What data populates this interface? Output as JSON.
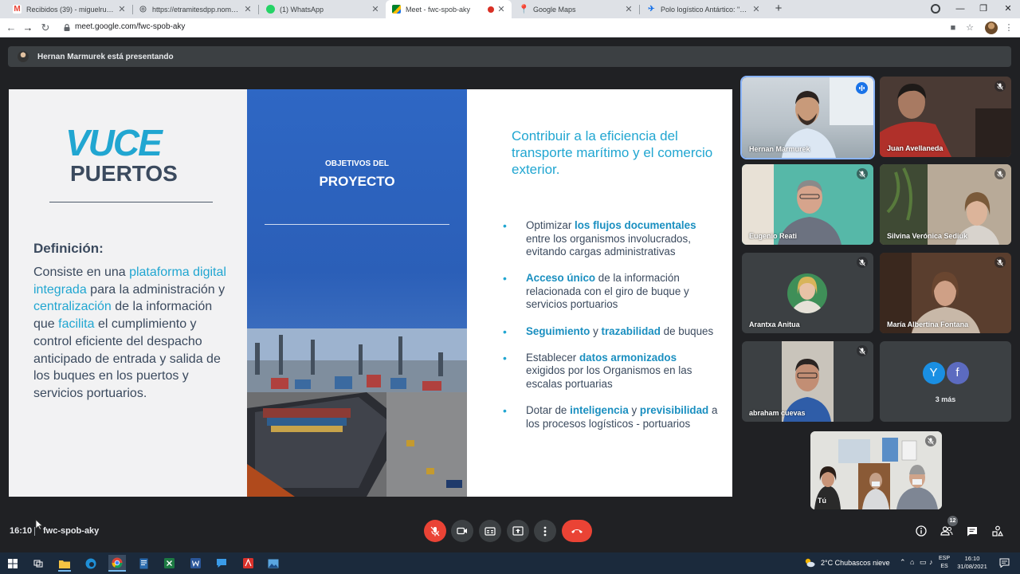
{
  "browser": {
    "tabs": [
      {
        "title": "Recibidos (39) - miguelrushuaia@",
        "icon": "gmail-icon",
        "color": "#ea4335",
        "active": false
      },
      {
        "title": "https://etramitesdpp.nomadesoft",
        "icon": "globe-icon",
        "color": "#5f6368",
        "active": false
      },
      {
        "title": "(1) WhatsApp",
        "icon": "whatsapp-icon",
        "color": "#25d366",
        "active": false
      },
      {
        "title": "Meet - fwc-spob-aky",
        "icon": "meet-icon",
        "color": "#00832d",
        "active": true
      },
      {
        "title": "Google Maps",
        "icon": "maps-icon",
        "color": "#34a853",
        "active": false
      },
      {
        "title": "Polo logístico Antártico: \"Debem",
        "icon": "news-icon",
        "color": "#1a73e8",
        "active": false
      }
    ],
    "new_tab": "+",
    "url": "meet.google.com/fwc-spob-aky"
  },
  "meet": {
    "presenting_text": "Hernan Marmurek está presentando",
    "slide": {
      "logo_top": "VUCE",
      "logo_bottom": "PUERTOS",
      "definition_title": "Definición:",
      "definition_parts": {
        "p1": "Consiste en una ",
        "h1": "plataforma digital integrada",
        "p2": " para la administración y ",
        "h2": "centralización",
        "p3": " de la información que ",
        "h3": "facilita",
        "p4": " el cumplimiento y control eficiente del despacho anticipado de entrada y salida de los buques en los puertos y servicios portuarios."
      },
      "objectives_small": "OBJETIVOS DEL",
      "objectives_big": "PROYECTO",
      "headline": "Contribuir a la eficiencia del transporte marítimo y el comercio exterior.",
      "bullets": [
        {
          "a": "Optimizar ",
          "b": "los flujos documentales",
          "c": " entre los organismos involucrados, evitando cargas administrativas",
          "d": "",
          "e": ""
        },
        {
          "a": "",
          "b": "Acceso único",
          "c": " de la información relacionada con el giro de buque y servicios portuarios",
          "d": "",
          "e": ""
        },
        {
          "a": "",
          "b": "Seguimiento",
          "c": " y ",
          "d": "trazabilidad",
          "e": " de buques"
        },
        {
          "a": "Establecer ",
          "b": "datos armonizados",
          "c": " exigidos por los Organismos en las escalas portuarias",
          "d": "",
          "e": ""
        },
        {
          "a": "Dotar de ",
          "b": "inteligencia",
          "c": " y ",
          "d": "previsibilidad",
          "e": " a los procesos logísticos - portuarios"
        }
      ]
    },
    "participants": [
      {
        "name": "Hernan Marmurek",
        "state": "speaking"
      },
      {
        "name": "Juan Avellaneda",
        "state": "muted"
      },
      {
        "name": "Eugenio Reati",
        "state": "muted"
      },
      {
        "name": "Silvina Verónica Sediuk",
        "state": "muted"
      },
      {
        "name": "Arantxa Anitua",
        "state": "muted"
      },
      {
        "name": "María Albertina Fontana",
        "state": "muted"
      },
      {
        "name": "abraham cuevas",
        "state": "muted"
      }
    ],
    "more": {
      "avatars": [
        {
          "letter": "Y",
          "color": "#1a8fe3"
        },
        {
          "letter": "f",
          "color": "#5c6bc0"
        }
      ],
      "label": "3 más"
    },
    "self_tile": {
      "name": "Tú"
    },
    "clock": "16:10",
    "meeting_code": "fwc-spob-aky",
    "people_count": "12"
  },
  "taskbar": {
    "weather": "2°C  Chubascos nieve",
    "lang_top": "ESP",
    "lang_bottom": "ES",
    "time": "16:10",
    "date": "31/08/2021"
  }
}
